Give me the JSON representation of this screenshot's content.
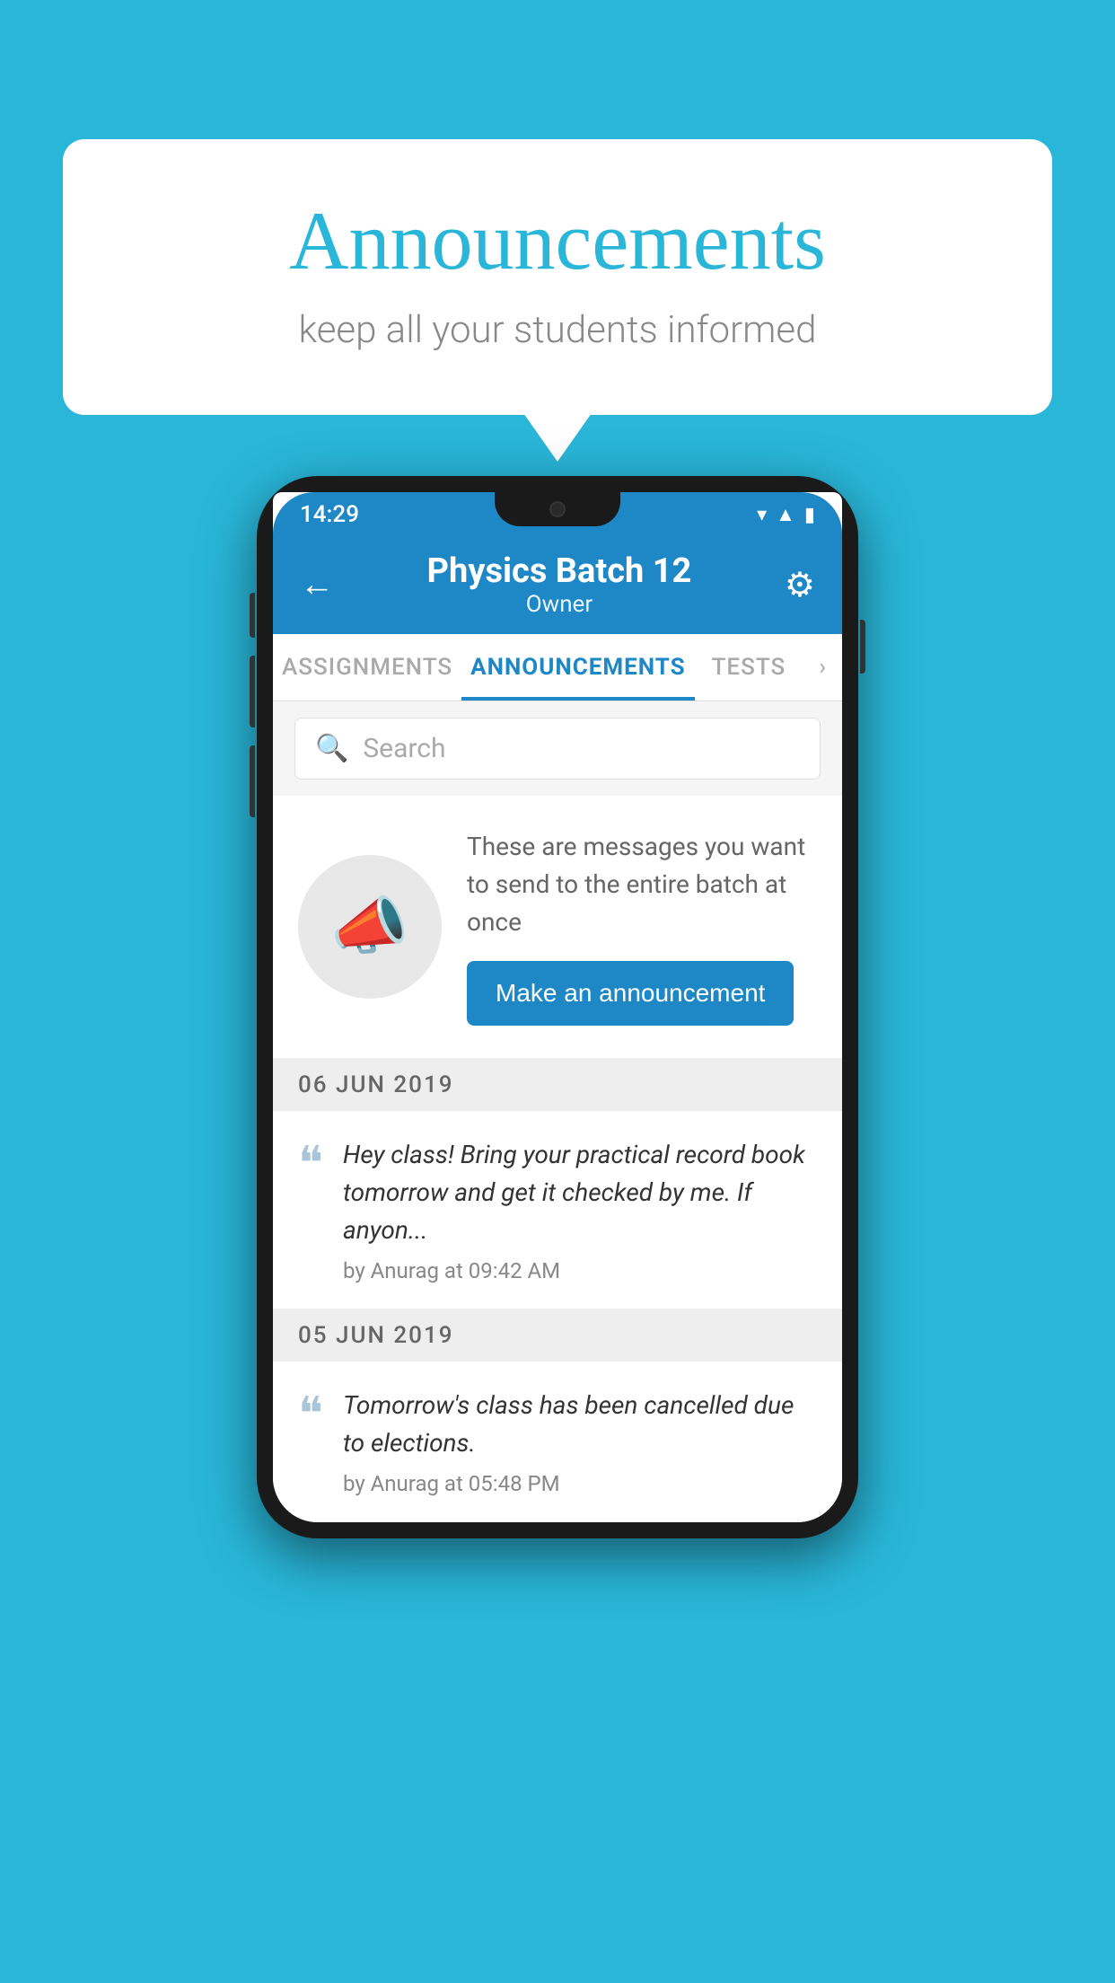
{
  "page": {
    "background_color": "#29b6d8"
  },
  "speech_bubble": {
    "title": "Announcements",
    "subtitle": "keep all your students informed"
  },
  "phone": {
    "status_bar": {
      "time": "14:29",
      "icons": [
        "wifi",
        "signal",
        "battery"
      ]
    },
    "header": {
      "title": "Physics Batch 12",
      "subtitle": "Owner",
      "back_label": "←",
      "settings_label": "⚙"
    },
    "tabs": [
      {
        "label": "ASSIGNMENTS",
        "active": false
      },
      {
        "label": "ANNOUNCEMENTS",
        "active": true
      },
      {
        "label": "TESTS",
        "active": false
      }
    ],
    "search": {
      "placeholder": "Search"
    },
    "announcement_prompt": {
      "description": "These are messages you want to send to the entire batch at once",
      "button_label": "Make an announcement"
    },
    "announcements": [
      {
        "date": "06  JUN  2019",
        "text": "Hey class! Bring your practical record book tomorrow and get it checked by me. If anyon...",
        "meta": "by Anurag at 09:42 AM"
      },
      {
        "date": "05  JUN  2019",
        "text": "Tomorrow's class has been cancelled due to elections.",
        "meta": "by Anurag at 05:48 PM"
      }
    ]
  }
}
